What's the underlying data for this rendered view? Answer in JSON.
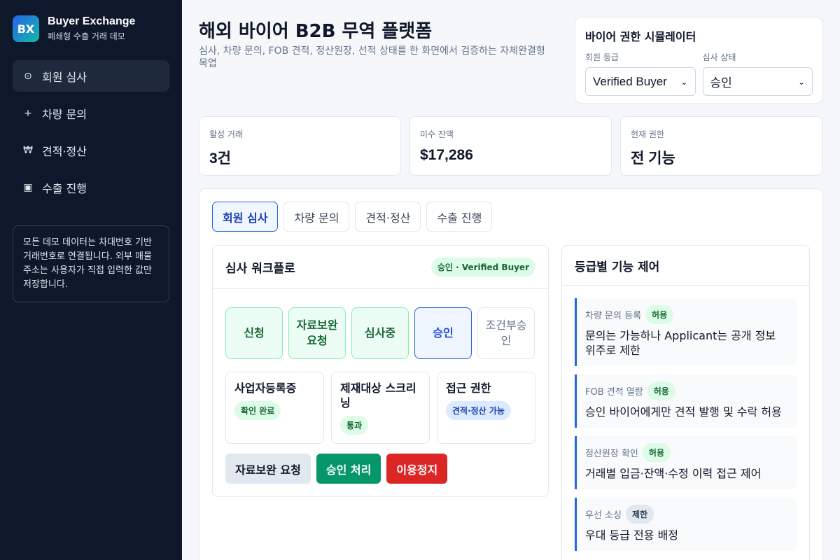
{
  "brand": {
    "logo": "BX",
    "name": "Buyer Exchange",
    "subtitle": "폐쇄형 수출 거래 데모"
  },
  "sidebar": {
    "items": [
      {
        "icon": "⊙",
        "label": "회원 심사",
        "active": true
      },
      {
        "icon": "+",
        "label": "차량 문의"
      },
      {
        "icon": "₩",
        "label": "견적·정산"
      },
      {
        "icon": "▣",
        "label": "수출 진행"
      }
    ],
    "note": "모든 데모 데이터는 차대번호 기반 거래번호로 연결됩니다. 외부 매물 주소는 사용자가 직접 입력한 값만 저장합니다."
  },
  "header": {
    "title": "해외 바이어 B2B 무역 플랫폼",
    "subtitle": "심사, 차량 문의, FOB 견적, 정산원장, 선적 상태를 한 화면에서 검증하는 자체완결형 목업"
  },
  "simulator": {
    "title": "바이어 권한 시뮬레이터",
    "grade_label": "회원 등급",
    "grade_value": "Verified Buyer",
    "status_label": "심사 상태",
    "status_value": "승인"
  },
  "stats": [
    {
      "label": "활성 거래",
      "value": "3건"
    },
    {
      "label": "미수 잔액",
      "value": "$17,286"
    },
    {
      "label": "현재 권한",
      "value": "전 기능"
    }
  ],
  "tabs": [
    {
      "label": "회원 심사",
      "active": true
    },
    {
      "label": "차량 문의"
    },
    {
      "label": "견적·정산"
    },
    {
      "label": "수출 진행"
    }
  ],
  "workflow": {
    "title": "심사 워크플로",
    "badge": "승인 · Verified Buyer",
    "steps": [
      {
        "label": "신청",
        "state": "done"
      },
      {
        "label": "자료보완 요청",
        "state": "done"
      },
      {
        "label": "심사중",
        "state": "done"
      },
      {
        "label": "승인",
        "state": "current"
      },
      {
        "label": "조건부승인",
        "state": "todo"
      }
    ],
    "checks": [
      {
        "title": "사업자등록증",
        "badge": "확인 완료",
        "tone": "green"
      },
      {
        "title": "제재대상 스크리닝",
        "badge": "통과",
        "tone": "green"
      },
      {
        "title": "접근 권한",
        "badge": "견적·정산 가능",
        "tone": "blue"
      }
    ],
    "actions": {
      "request": "자료보완 요청",
      "approve": "승인 처리",
      "suspend": "이용정지"
    }
  },
  "permissions": {
    "title": "등급별 기능 제어",
    "items": [
      {
        "name": "차량 문의 등록",
        "badge": "허용",
        "tone": "green",
        "desc": "문의는 가능하나 Applicant는 공개 정보 위주로 제한"
      },
      {
        "name": "FOB 견적 열람",
        "badge": "허용",
        "tone": "green",
        "desc": "승인 바이어에게만 견적 발행 및 수락 허용"
      },
      {
        "name": "정산원장 확인",
        "badge": "허용",
        "tone": "green",
        "desc": "거래별 입금·잔액·수정 이력 접근 제어"
      },
      {
        "name": "우선 소싱",
        "badge": "제한",
        "tone": "gray",
        "desc": "우대 등급 전용 배정"
      }
    ]
  },
  "colors": {
    "sidebar_bg": "#0f172a",
    "accent": "#2563eb",
    "success": "#059669",
    "danger": "#dc2626"
  }
}
